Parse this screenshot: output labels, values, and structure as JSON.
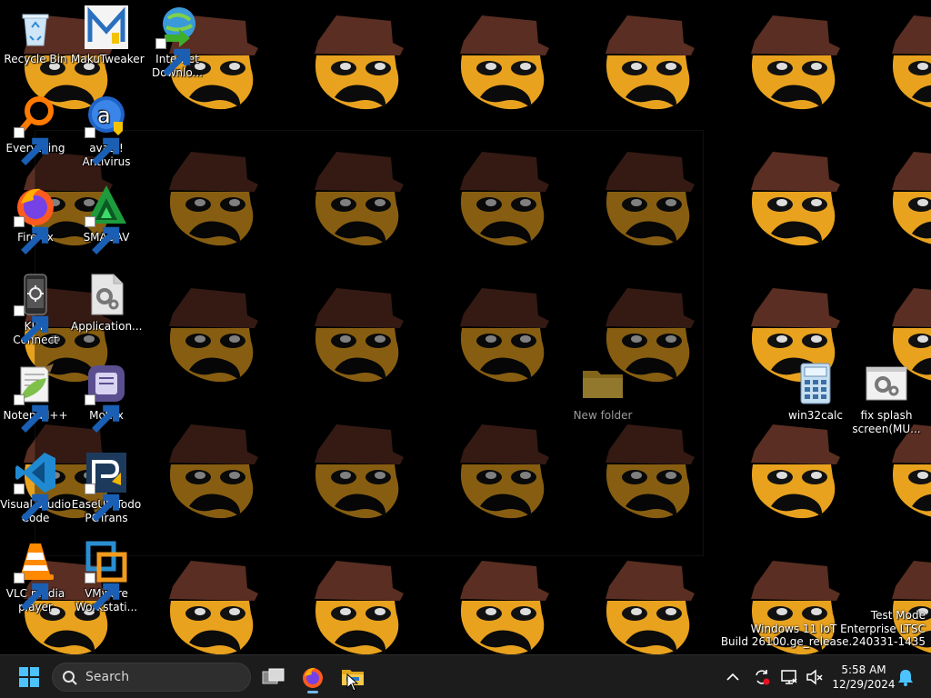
{
  "desktop": {
    "icons": [
      {
        "label_1": "Recycle Bin",
        "label_2": ""
      },
      {
        "label_1": "MakuTweaker",
        "label_2": ""
      },
      {
        "label_1": "Internet",
        "label_2": "Downlo..."
      },
      {
        "label_1": "Everything",
        "label_2": ""
      },
      {
        "label_1": "avast!",
        "label_2": "Antivirus"
      },
      {
        "label_1": "Firefox",
        "label_2": ""
      },
      {
        "label_1": "SMADAV",
        "label_2": ""
      },
      {
        "label_1": "KDE Connect",
        "label_2": ""
      },
      {
        "label_1": "Application...",
        "label_2": ""
      },
      {
        "label_1": "Notepad++",
        "label_2": ""
      },
      {
        "label_1": "Motrix",
        "label_2": ""
      },
      {
        "label_1": "Visual Studio",
        "label_2": "Code"
      },
      {
        "label_1": "EaseUS Todo",
        "label_2": "PCTrans"
      },
      {
        "label_1": "VLC media",
        "label_2": "player"
      },
      {
        "label_1": "VMware",
        "label_2": "Workstati..."
      },
      {
        "label_1": "New folder",
        "label_2": ""
      },
      {
        "label_1": "win32calc",
        "label_2": ""
      },
      {
        "label_1": "fix splash",
        "label_2": "screen(MU..."
      }
    ]
  },
  "watermark": {
    "line1": "Test Mode",
    "line2": "Windows 11 IoT Enterprise LTSC",
    "line3": "Build 26100.ge_release.240331-1435"
  },
  "taskbar": {
    "search_label": "Search",
    "time": "5:58 AM",
    "date": "12/29/2024",
    "icons": [
      "start-icon",
      "search-icon",
      "task-view-icon",
      "firefox-icon",
      "file-explorer-icon",
      "chevron-up-icon",
      "sync-icon",
      "network-icon",
      "volume-muted-icon",
      "notification-bell-icon"
    ]
  },
  "colors": {
    "taskbar_bg": "#1c1c1c",
    "accent": "#6cb8f0",
    "wallpaper_bg": "#000000",
    "wallpaper_hat": "#5a2e22",
    "wallpaper_face": "#e8a21e"
  }
}
